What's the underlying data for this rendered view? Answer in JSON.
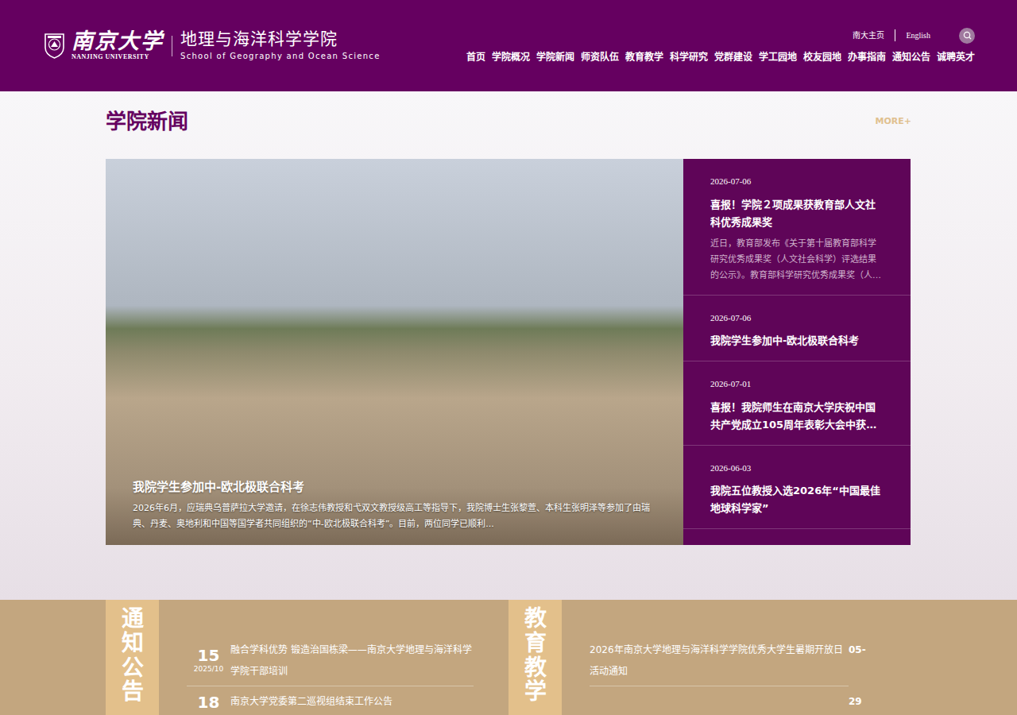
{
  "header": {
    "logo": {
      "cn": "南京大学",
      "en": "NANJING UNIVERSITY",
      "school_cn": "地理与海洋科学学院",
      "school_en": "School of Geography and Ocean Science"
    },
    "top_links": [
      "南大主页",
      "English"
    ],
    "nav": [
      "首页",
      "学院概况",
      "学院新闻",
      "师资队伍",
      "教育教学",
      "科学研究",
      "党群建设",
      "学工园地",
      "校友园地",
      "办事指南",
      "通知公告",
      "诚聘英才"
    ]
  },
  "news": {
    "title": "学院新闻",
    "more": "MORE+",
    "featured": {
      "title": "我院学生参加中-欧北极联合科考",
      "summary": "2026年6月，应瑞典乌普萨拉大学邀请，在徐志伟教授和弋双文教授级高工等指导下，我院博士生张黎萱、本科生张明泽等参加了由瑞典、丹麦、奥地利和中国等国学者共同组织的“中-欧北极联合科考”。目前，两位同学已顺利..."
    },
    "items": [
      {
        "date": "2026-07-06",
        "title": "喜报！学院２项成果获教育部人文社科优秀成果奖",
        "summary": "近日，教育部发布《关于第十届教育部科学研究优秀成果奖（人文社会科学）评选结果的公示》。教育部科学研究优秀成果奖（人…"
      },
      {
        "date": "2026-07-06",
        "title": "我院学生参加中-欧北极联合科考"
      },
      {
        "date": "2026-07-01",
        "title": "喜报！我院师生在南京大学庆祝中国共产党成立105周年表彰大会中获…"
      },
      {
        "date": "2026-06-03",
        "title": "我院五位教授入选2026年“中国最佳地球科学家”"
      }
    ]
  },
  "notices": {
    "title": "通知公告",
    "items": [
      {
        "day": "15",
        "month": "2025/10",
        "title": "融合学科优势 锻造治国栋梁——南京大学地理与海洋科学学院干部培训"
      },
      {
        "day": "18",
        "title": "南京大学党委第二巡视组结束工作公告"
      }
    ]
  },
  "education": {
    "title": "教育教学",
    "items": [
      {
        "title": "2026年南京大学地理与海洋科学学院优秀大学生暑期开放日活动通知",
        "date": "05-"
      },
      {
        "date": "29"
      }
    ]
  }
}
